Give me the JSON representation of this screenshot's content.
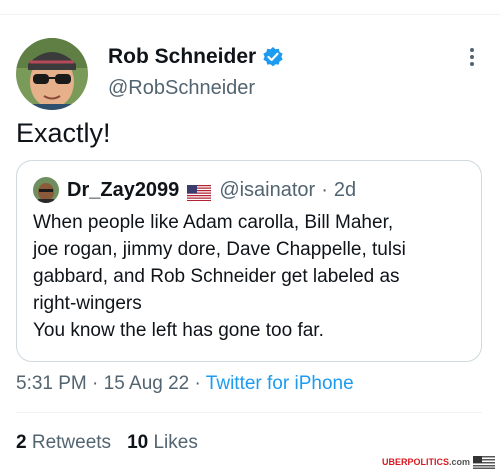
{
  "author": {
    "name": "Rob Schneider",
    "handle": "@RobSchneider"
  },
  "tweet": {
    "text": "Exactly!"
  },
  "quoted": {
    "name": "Dr_Zay2099",
    "handle": "@isainator",
    "separator": "·",
    "time": "2d",
    "lines": [
      "When people like Adam carolla,  Bill Maher,",
      "joe rogan, jimmy dore, Dave Chappelle, tulsi",
      "gabbard, and Rob Schneider get labeled as",
      "right-wingers",
      "You know the left has gone too far."
    ]
  },
  "meta": {
    "time": "5:31 PM",
    "date": "15 Aug 22",
    "separator": "·",
    "source": "Twitter for iPhone"
  },
  "stats": {
    "retweets_count": "2",
    "retweets_label": "Retweets",
    "likes_count": "10",
    "likes_label": "Likes"
  },
  "watermark": {
    "part1": "UBERPOLITICS",
    "part2": ".com"
  },
  "colors": {
    "accent": "#1d9bf0",
    "secondary": "#536471",
    "border": "#cfd9de"
  },
  "icons": {
    "verified": "verified-badge-icon",
    "more": "more-dots-icon",
    "flag": "us-flag-icon"
  }
}
